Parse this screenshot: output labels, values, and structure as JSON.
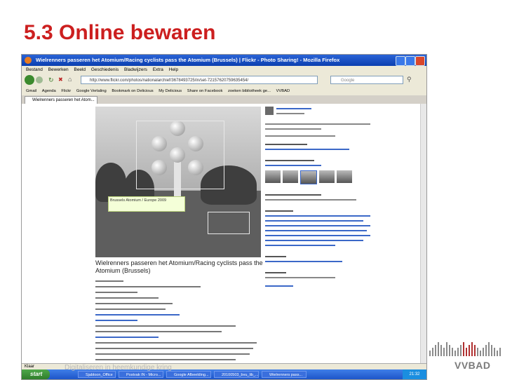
{
  "slide": {
    "title": "5.3 Online bewaren",
    "footer": "Digitaliseren in heemkundige kring",
    "logo": "VVBAD"
  },
  "browser": {
    "window_title": "Wielrenners passeren het Atomium/Racing cyclists pass the Atomium (Brussels) | Flickr - Photo Sharing! - Mozilla Firefox",
    "menu": [
      "Bestand",
      "Bewerken",
      "Beeld",
      "Geschiedenis",
      "Bladwijzers",
      "Extra",
      "Help"
    ],
    "url": "http://www.flickr.com/photos/nationalarchief/3678493725/in/set-72157620759635454/",
    "search_placeholder": "Google",
    "bookmarks": [
      "Gmail",
      "Agenda",
      "Flickr",
      "Google Vertaling",
      "Bookmark on Delicious",
      "My Delicious",
      "Share on Facebook",
      "zoeken bibliotheek ge...",
      "VVBAD"
    ],
    "tab_label": "Wielrenners passeren het Atom...",
    "status_text": "Klaar"
  },
  "flickr": {
    "note_text": "Brussels Atomium / Europe 2009",
    "photo_title": "Wielrenners passeren het Atomium/Racing cyclists pass the Atomium (Brussels)"
  },
  "taskbar": {
    "start_label": "start",
    "items": [
      "Sjabloon_Office",
      "Postvak IN - Micro...",
      "Google Afbeelding...",
      "20100503_bvu_lib_...",
      "Wielrenners pass..."
    ],
    "clock": "21:32"
  }
}
